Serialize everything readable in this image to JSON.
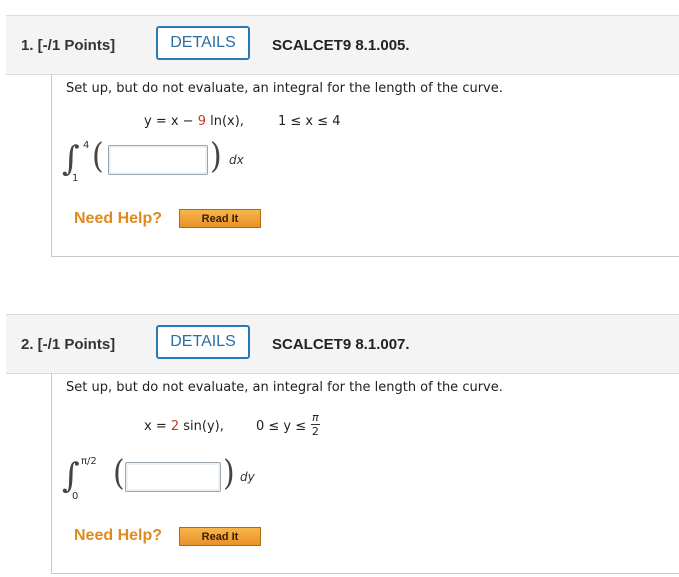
{
  "questions": [
    {
      "number_label": "1. [-/1 Points]",
      "details_label": "DETAILS",
      "code": "SCALCET9 8.1.005.",
      "prompt": "Set up, but do not evaluate, an integral for the length of the curve.",
      "equation_lhs": "y = x − ",
      "equation_coef": "9",
      "equation_rest": " ln(x),",
      "range": "1 ≤ x ≤ 4",
      "lower_limit": "1",
      "upper_limit": "4",
      "differential": "dx",
      "answer_value": "",
      "need_help": "Need Help?",
      "read_it": "Read It"
    },
    {
      "number_label": "2. [-/1 Points]",
      "details_label": "DETAILS",
      "code": "SCALCET9 8.1.007.",
      "prompt": "Set up, but do not evaluate, an integral for the length of the curve.",
      "equation_lhs": "x = ",
      "equation_coef": "2",
      "equation_rest": " sin(y),",
      "range_prefix": "0 ≤ y ≤",
      "range_num": "π",
      "range_den": "2",
      "lower_limit": "0",
      "upper_limit": "π/2",
      "differential": "dy",
      "answer_value": "",
      "need_help": "Need Help?",
      "read_it": "Read It"
    }
  ],
  "colors": {
    "details_border": "#2a7ab8",
    "need_help": "#e08a1e",
    "coefficient_red": "#c0392b",
    "read_it_bg": "#f0a23a"
  }
}
